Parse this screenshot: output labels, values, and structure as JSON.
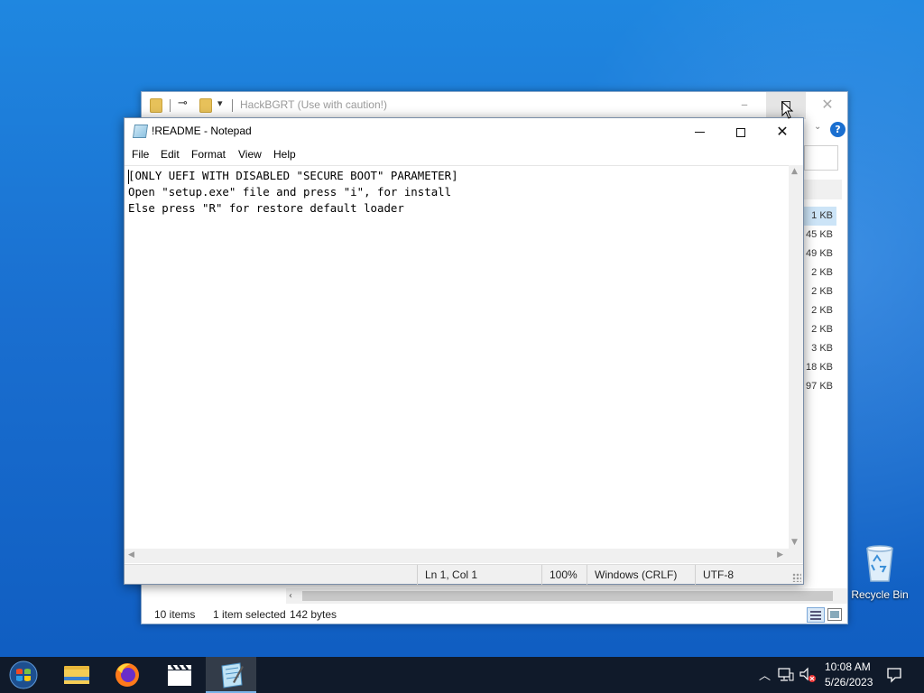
{
  "explorer": {
    "title": "HackBGRT (Use with caution!)",
    "help_label": "?",
    "sizes": [
      "1 KB",
      "45 KB",
      "49 KB",
      "2 KB",
      "2 KB",
      "2 KB",
      "2 KB",
      "3 KB",
      "18 KB",
      "97 KB"
    ],
    "status": {
      "items": "10 items",
      "selected": "1 item selected",
      "size": "142 bytes"
    }
  },
  "notepad": {
    "title": "!README - Notepad",
    "menu": [
      "File",
      "Edit",
      "Format",
      "View",
      "Help"
    ],
    "lines": [
      "[ONLY UEFI WITH DISABLED \"SECURE BOOT\" PARAMETER]",
      "Open \"setup.exe\" file and press \"i\", for install",
      "Else press \"R\" for restore default loader"
    ],
    "status": {
      "position": "Ln 1, Col 1",
      "zoom": "100%",
      "line_endings": "Windows (CRLF)",
      "encoding": "UTF-8"
    }
  },
  "desktop": {
    "recycle_bin_label": "Recycle Bin"
  },
  "taskbar": {
    "apps": [
      "windows-start-icon",
      "file-explorer-icon",
      "firefox-icon",
      "video-clapper-icon",
      "notepad-icon"
    ],
    "time": "10:08 AM",
    "date": "5/26/2023",
    "accent": "#0f5cc0"
  }
}
